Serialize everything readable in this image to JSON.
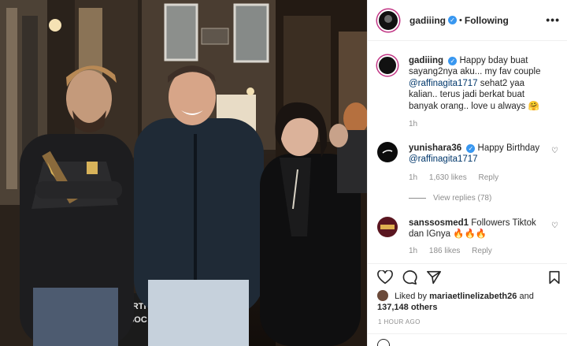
{
  "post": {
    "username": "gadiiing",
    "follow_status": "Following",
    "more_label": "•••"
  },
  "caption": {
    "username": "gadiiing",
    "text_1": "Happy bday buat sayang2nya aku... my fav couple",
    "mention": "@raffinagita1717",
    "text_2": "sehat2 yaa kalian.. terus jadi berkat buat banyak orang.. love u always",
    "emoji": "🤗",
    "time": "1h"
  },
  "comments": [
    {
      "username": "yunishara36",
      "text": "Happy Birthday",
      "mention": "@raffinagita1717",
      "time": "1h",
      "likes": "1,630 likes",
      "reply": "Reply",
      "view_replies": "View replies (78)"
    },
    {
      "username": "sanssosmed1",
      "text": "Followers Tiktok dan IGnya",
      "emoji": "🔥🔥🔥",
      "time": "1h",
      "likes": "186 likes",
      "reply": "Reply"
    }
  ],
  "likes": {
    "prefix": "Liked by",
    "user": "mariaetlinelizabeth26",
    "joiner": "and",
    "count": "137,148 others"
  },
  "timestamp": "1 HOUR AGO",
  "photo_sign": {
    "line1": "EPARTI",
    "line2": "ND SOC"
  },
  "colors": {
    "verified": "#3897f0",
    "mention": "#00376b",
    "muted": "#8e8e8e",
    "story_ring": "#c13584"
  }
}
